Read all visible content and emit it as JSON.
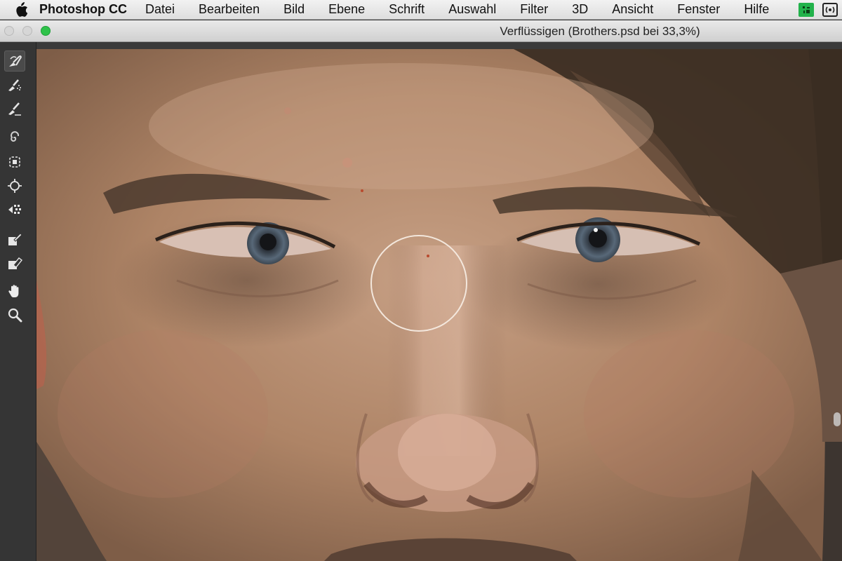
{
  "menubar": {
    "apple_icon": "apple-logo-icon",
    "app_name": "Photoshop CC",
    "items": [
      "Datei",
      "Bearbeiten",
      "Bild",
      "Ebene",
      "Schrift",
      "Auswahl",
      "Filter",
      "3D",
      "Ansicht",
      "Fenster",
      "Hilfe"
    ],
    "status_icons": [
      "green-app-status-icon",
      "broadcast-status-icon"
    ],
    "status_accent": "#22b24b"
  },
  "window": {
    "title": "Verflüssigen (Brothers.psd bei 33,3%)"
  },
  "tools": [
    {
      "name": "forward-warp-tool",
      "icon": "forward-warp-icon",
      "active": true
    },
    {
      "name": "reconstruct-tool",
      "icon": "reconstruct-icon",
      "active": false
    },
    {
      "name": "smooth-tool",
      "icon": "smooth-icon",
      "active": false
    },
    {
      "name": "twirl-clockwise-tool",
      "icon": "twirl-icon",
      "active": false
    },
    {
      "name": "pucker-tool",
      "icon": "pucker-icon",
      "active": false
    },
    {
      "name": "bloat-tool",
      "icon": "bloat-icon",
      "active": false
    },
    {
      "name": "push-left-tool",
      "icon": "push-left-icon",
      "active": false
    },
    {
      "name": "freeze-mask-tool",
      "icon": "freeze-mask-icon",
      "active": false
    },
    {
      "name": "thaw-mask-tool",
      "icon": "thaw-mask-icon",
      "active": false
    },
    {
      "name": "hand-tool",
      "icon": "hand-icon",
      "active": false
    },
    {
      "name": "zoom-tool",
      "icon": "zoom-icon",
      "active": false
    }
  ],
  "canvas": {
    "document": "Brothers.psd",
    "zoom": "33,3%"
  }
}
